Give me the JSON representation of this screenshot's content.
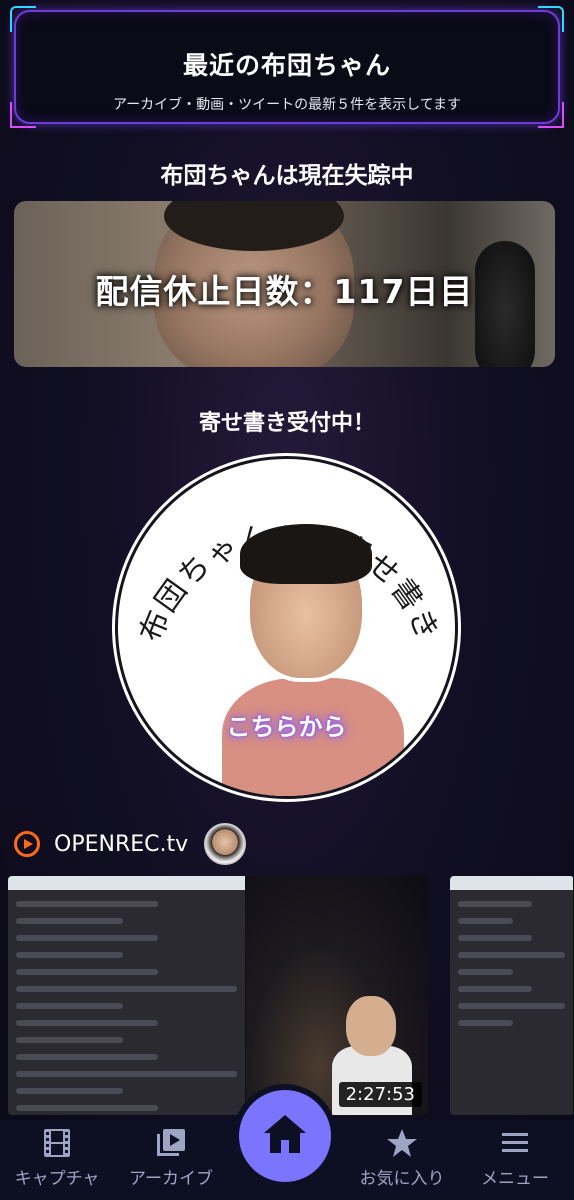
{
  "header": {
    "title": "最近の布団ちゃん",
    "subtitle": "アーカイブ・動画・ツイートの最新５件を表示してます"
  },
  "status": {
    "text": "布団ちゃんは現在失踪中",
    "days_banner": "配信休止日数：117日目"
  },
  "yosegaki": {
    "heading": "寄せ書き受付中！",
    "arc_text": "布団ちゃんへの寄せ書き",
    "cta": "こちらから"
  },
  "openrec": {
    "name": "OPENREC.tv",
    "logo_color": "#ff6a1a",
    "videos": [
      {
        "duration": "2:27:53"
      }
    ]
  },
  "nav": {
    "items": [
      {
        "label": "キャプチャ",
        "icon": "film-icon"
      },
      {
        "label": "アーカイブ",
        "icon": "video-library-icon"
      },
      {
        "label": "",
        "icon": "home-icon"
      },
      {
        "label": "お気に入り",
        "icon": "star-icon"
      },
      {
        "label": "メニュー",
        "icon": "menu-icon"
      }
    ],
    "accent": "#7a74ff"
  }
}
